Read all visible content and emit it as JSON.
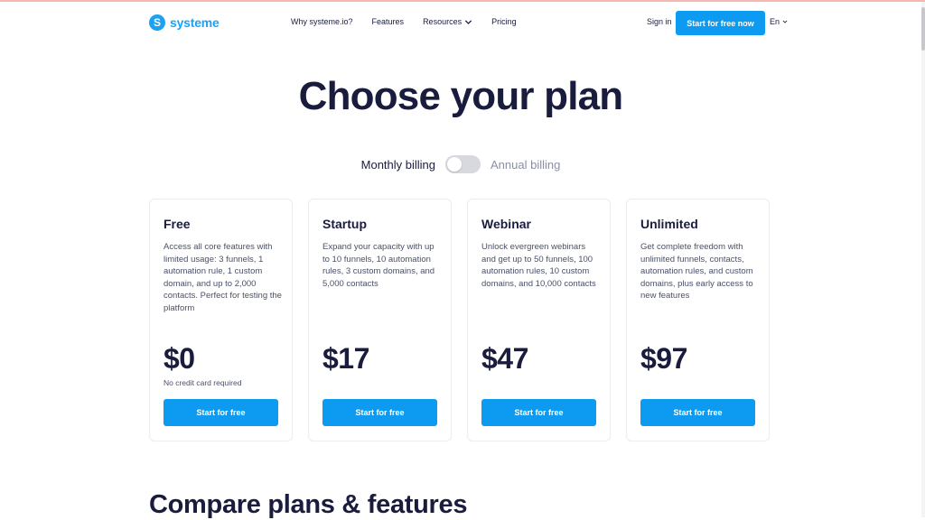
{
  "header": {
    "logo_text": "systeme",
    "logo_mark": "S",
    "nav": [
      {
        "label": "Why systeme.io?",
        "has_dropdown": false
      },
      {
        "label": "Features",
        "has_dropdown": false
      },
      {
        "label": "Resources",
        "has_dropdown": true
      },
      {
        "label": "Pricing",
        "has_dropdown": false
      }
    ],
    "signin_label": "Sign in",
    "cta_label": "Start for free now",
    "language": "En"
  },
  "hero": {
    "title": "Choose your plan"
  },
  "billing": {
    "monthly_label": "Monthly billing",
    "annual_label": "Annual billing",
    "annual_selected": false
  },
  "plans": [
    {
      "name": "Free",
      "description": "Access all core features with limited usage: 3 funnels, 1 automation rule, 1 custom domain, and up to 2,000 contacts. Perfect for testing the platform",
      "price": "$0",
      "note": "No credit card required",
      "button_label": "Start for free"
    },
    {
      "name": "Startup",
      "description": "Expand your capacity with up to 10 funnels, 10 automation rules, 3 custom domains, and 5,000 contacts",
      "price": "$17",
      "note": "",
      "button_label": "Start for free"
    },
    {
      "name": "Webinar",
      "description": "Unlock evergreen webinars and get up to 50 funnels, 100 automation rules, 10 custom domains, and 10,000 contacts",
      "price": "$47",
      "note": "",
      "button_label": "Start for free"
    },
    {
      "name": "Unlimited",
      "description": "Get complete freedom with unlimited funnels, contacts, automation rules, and custom domains, plus early access to new features",
      "price": "$97",
      "note": "",
      "button_label": "Start for free"
    }
  ],
  "compare": {
    "title": "Compare plans & features"
  },
  "colors": {
    "brand": "#1da1f2",
    "button": "#0d9bf2",
    "heading": "#1a1c3d",
    "body_text": "#4a5068"
  }
}
